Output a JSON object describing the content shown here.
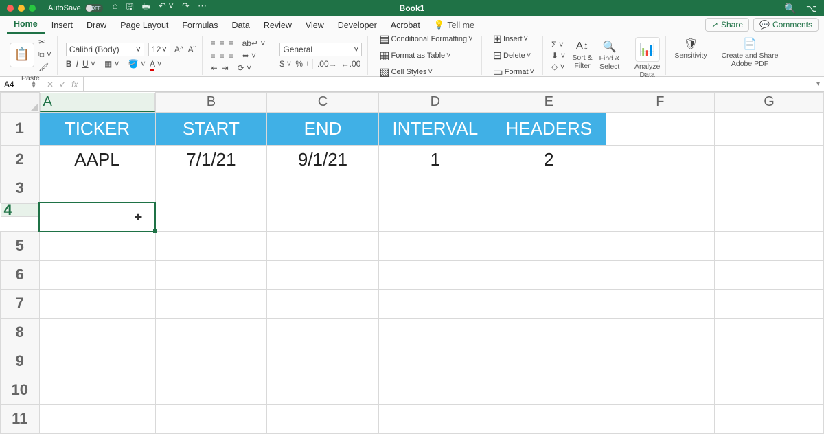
{
  "titlebar": {
    "autosave_label": "AutoSave",
    "autosave_state": "OFF",
    "doc_title": "Book1"
  },
  "tabs": {
    "home": "Home",
    "insert": "Insert",
    "draw": "Draw",
    "pagelayout": "Page Layout",
    "formulas": "Formulas",
    "data": "Data",
    "review": "Review",
    "view": "View",
    "developer": "Developer",
    "acrobat": "Acrobat",
    "tellme": "Tell me",
    "share": "Share",
    "comments": "Comments"
  },
  "ribbon": {
    "paste": "Paste",
    "font_name": "Calibri (Body)",
    "font_size": "12",
    "number_format": "General",
    "cond_fmt": "Conditional Formatting",
    "fmt_table": "Format as Table",
    "cell_styles": "Cell Styles",
    "insert": "Insert",
    "delete": "Delete",
    "format": "Format",
    "sort_filter": "Sort &\nFilter",
    "find_select": "Find &\nSelect",
    "analyze": "Analyze\nData",
    "sensitivity": "Sensitivity",
    "create_pdf": "Create and Share\nAdobe PDF"
  },
  "namebox": "A4",
  "columns": [
    "A",
    "B",
    "C",
    "D",
    "E",
    "F",
    "G"
  ],
  "rows": [
    "1",
    "2",
    "3",
    "4",
    "5",
    "6",
    "7",
    "8",
    "9",
    "10",
    "11"
  ],
  "cells": {
    "header": [
      "TICKER",
      "START",
      "END",
      "INTERVAL",
      "HEADERS"
    ],
    "data": [
      "AAPL",
      "7/1/21",
      "9/1/21",
      "1",
      "2"
    ]
  },
  "selected_cell": "A4"
}
